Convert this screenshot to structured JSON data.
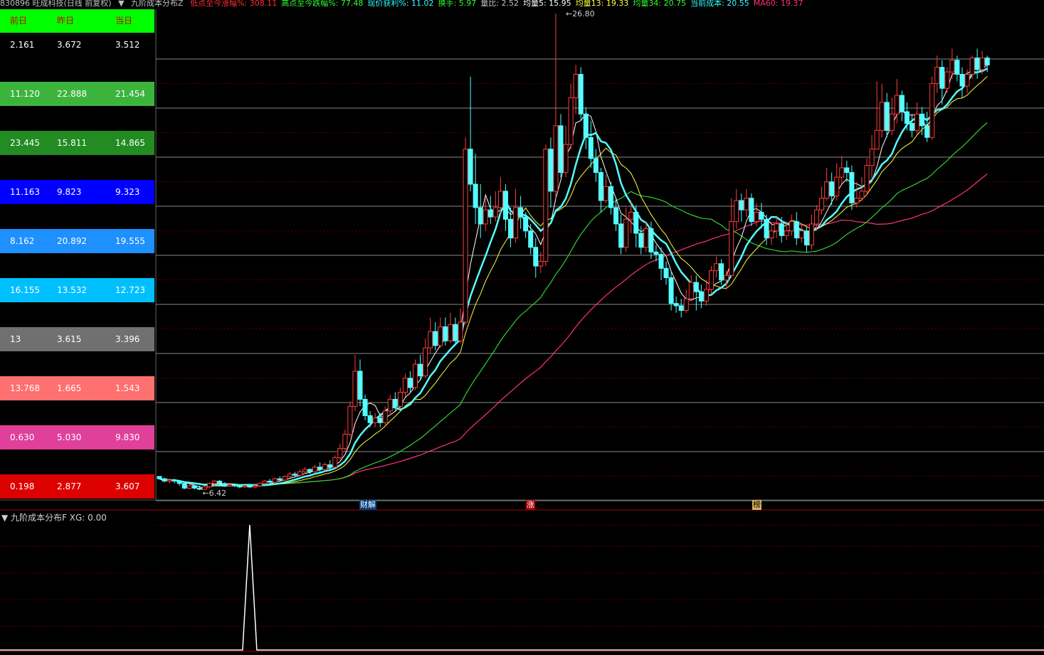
{
  "header": {
    "stock": "830896 旺成科技(日线 前复权)",
    "indicator": "九阶成本分布Z",
    "items": [
      {
        "label": "低点至今涨幅%: 308.11",
        "color": "#ff3030"
      },
      {
        "label": "高点至今跌幅%: 77.48",
        "color": "#30ff30"
      },
      {
        "label": "现价获利%: 11.02",
        "color": "#30ffff"
      },
      {
        "label": "换手: 5.97",
        "color": "#30ff30"
      },
      {
        "label": "量比: 2.52",
        "color": "#c0c0c0"
      },
      {
        "label": "均量5: 15.95",
        "color": "#ffffff"
      },
      {
        "label": "均量13: 19.33",
        "color": "#ffff40"
      },
      {
        "label": "均量34: 20.75",
        "color": "#30ff30"
      },
      {
        "label": "当前成本: 20.55",
        "color": "#30ffff"
      },
      {
        "label": "MA60: 19.37",
        "color": "#ff3080"
      }
    ]
  },
  "table": {
    "headers": [
      "前日",
      "昨日",
      "当日"
    ],
    "rows": [
      {
        "values": [
          "2.161",
          "3.672",
          "3.512"
        ],
        "bg": "#000000",
        "fg": "#ffffff"
      },
      {
        "values": [
          "11.120",
          "22.888",
          "21.454"
        ],
        "bg": "#3cb43c",
        "fg": "#ffffff"
      },
      {
        "values": [
          "23.445",
          "15.811",
          "14.865"
        ],
        "bg": "#228b22",
        "fg": "#ffffff"
      },
      {
        "values": [
          "11.163",
          "9.823",
          "9.323"
        ],
        "bg": "#0000ff",
        "fg": "#ffffff"
      },
      {
        "values": [
          "8.162",
          "20.892",
          "19.555"
        ],
        "bg": "#1e90ff",
        "fg": "#ffffff"
      },
      {
        "values": [
          "16.155",
          "13.532",
          "12.723"
        ],
        "bg": "#00bfff",
        "fg": "#ffffff"
      },
      {
        "values": [
          "13",
          "3.615",
          "3.396"
        ],
        "bg": "#707070",
        "fg": "#ffffff"
      },
      {
        "values": [
          "13.768",
          "1.665",
          "1.543"
        ],
        "bg": "#ff7070",
        "fg": "#ffffff"
      },
      {
        "values": [
          "0.630",
          "5.030",
          "9.830"
        ],
        "bg": "#e0409a",
        "fg": "#ffffff"
      },
      {
        "values": [
          "0.198",
          "2.877",
          "3.607"
        ],
        "bg": "#dd0000",
        "fg": "#ffffff"
      }
    ]
  },
  "annotations": {
    "high": "26.80",
    "low": "6.42"
  },
  "markers": [
    "财",
    "解",
    "涨",
    "榜"
  ],
  "lower": {
    "title": "九阶成本分布F  XG: 0.00"
  },
  "colors": {
    "up": "#ff3c3c",
    "down": "#54ffff",
    "ma5": "#ffffff",
    "ma13": "#ffff40",
    "ma34": "#30d030",
    "cost": "#54ffff",
    "ma60": "#ff3080"
  },
  "chart_data": {
    "type": "candlestick",
    "price_range": [
      6.42,
      26.8
    ],
    "candles": [
      [
        7.0,
        6.9,
        7.0,
        6.9
      ],
      [
        6.9,
        6.8,
        6.95,
        6.75
      ],
      [
        6.8,
        6.85,
        6.9,
        6.7
      ],
      [
        6.85,
        6.8,
        6.9,
        6.7
      ],
      [
        6.8,
        6.7,
        6.85,
        6.6
      ],
      [
        6.7,
        6.5,
        6.75,
        6.45
      ],
      [
        6.5,
        6.6,
        6.65,
        6.45
      ],
      [
        6.6,
        6.5,
        6.65,
        6.45
      ],
      [
        6.5,
        6.45,
        6.6,
        6.42
      ],
      [
        6.45,
        6.55,
        6.6,
        6.42
      ],
      [
        6.55,
        6.7,
        6.75,
        6.5
      ],
      [
        6.7,
        6.8,
        6.85,
        6.6
      ],
      [
        6.8,
        6.7,
        6.85,
        6.65
      ],
      [
        6.7,
        6.6,
        6.75,
        6.55
      ],
      [
        6.6,
        6.65,
        6.7,
        6.55
      ],
      [
        6.65,
        6.6,
        6.7,
        6.55
      ],
      [
        6.6,
        6.55,
        6.65,
        6.5
      ],
      [
        6.55,
        6.6,
        6.65,
        6.5
      ],
      [
        6.6,
        6.55,
        6.65,
        6.5
      ],
      [
        6.55,
        6.6,
        6.7,
        6.5
      ],
      [
        6.6,
        6.7,
        6.75,
        6.55
      ],
      [
        6.7,
        6.8,
        6.85,
        6.65
      ],
      [
        6.8,
        6.75,
        6.9,
        6.7
      ],
      [
        6.75,
        6.9,
        6.95,
        6.7
      ],
      [
        6.9,
        6.85,
        7.0,
        6.8
      ],
      [
        6.85,
        7.0,
        7.05,
        6.8
      ],
      [
        7.0,
        7.1,
        7.2,
        6.95
      ],
      [
        7.1,
        7.05,
        7.2,
        7.0
      ],
      [
        7.05,
        7.2,
        7.3,
        7.0
      ],
      [
        7.2,
        7.3,
        7.4,
        7.1
      ],
      [
        7.3,
        7.2,
        7.35,
        7.1
      ],
      [
        7.2,
        7.4,
        7.5,
        7.15
      ],
      [
        7.4,
        7.3,
        7.6,
        7.2
      ],
      [
        7.3,
        7.5,
        7.6,
        7.25
      ],
      [
        7.5,
        7.4,
        7.7,
        7.3
      ],
      [
        7.4,
        7.8,
        7.9,
        7.35
      ],
      [
        7.8,
        8.2,
        8.4,
        7.7
      ],
      [
        8.2,
        8.8,
        9.0,
        8.1
      ],
      [
        8.8,
        10.0,
        10.2,
        8.7
      ],
      [
        10.0,
        11.5,
        12.2,
        9.8
      ],
      [
        11.5,
        10.3,
        12.0,
        10.0
      ],
      [
        10.3,
        9.6,
        10.5,
        9.4
      ],
      [
        9.6,
        9.3,
        9.8,
        9.1
      ],
      [
        9.3,
        9.5,
        9.7,
        9.1
      ],
      [
        9.5,
        9.3,
        9.7,
        9.1
      ],
      [
        9.3,
        9.8,
        10.0,
        9.2
      ],
      [
        9.8,
        10.3,
        10.5,
        9.6
      ],
      [
        10.3,
        10.0,
        10.6,
        9.8
      ],
      [
        10.0,
        10.6,
        10.8,
        9.9
      ],
      [
        10.6,
        11.2,
        11.4,
        10.4
      ],
      [
        11.2,
        10.8,
        11.5,
        10.6
      ],
      [
        10.8,
        11.8,
        12.0,
        10.7
      ],
      [
        11.8,
        11.3,
        12.2,
        11.1
      ],
      [
        11.3,
        12.5,
        12.9,
        11.2
      ],
      [
        12.5,
        13.2,
        13.8,
        12.3
      ],
      [
        13.2,
        12.6,
        13.6,
        12.4
      ],
      [
        12.6,
        13.4,
        13.8,
        12.5
      ],
      [
        13.4,
        12.8,
        13.8,
        12.6
      ],
      [
        12.8,
        13.5,
        14.0,
        12.7
      ],
      [
        13.5,
        12.8,
        13.8,
        12.6
      ],
      [
        12.8,
        13.6,
        14.2,
        12.7
      ],
      [
        13.6,
        21.0,
        21.5,
        13.5
      ],
      [
        21.0,
        19.5,
        24.1,
        19.2
      ],
      [
        19.5,
        18.5,
        20.8,
        17.8
      ],
      [
        18.5,
        17.8,
        19.5,
        17.2
      ],
      [
        17.8,
        18.4,
        18.9,
        17.5
      ],
      [
        18.4,
        18.1,
        19.0,
        17.8
      ],
      [
        18.1,
        18.5,
        19.2,
        17.9
      ],
      [
        18.5,
        19.2,
        19.8,
        18.2
      ],
      [
        19.2,
        18.0,
        19.5,
        17.5
      ],
      [
        18.0,
        17.2,
        18.5,
        16.8
      ],
      [
        17.2,
        18.5,
        19.3,
        17.0
      ],
      [
        18.5,
        18.1,
        19.0,
        17.6
      ],
      [
        18.1,
        17.5,
        18.3,
        17.2
      ],
      [
        17.5,
        16.8,
        17.8,
        16.5
      ],
      [
        16.8,
        16.0,
        17.2,
        15.5
      ],
      [
        16.0,
        16.2,
        16.6,
        15.7
      ],
      [
        16.2,
        21.0,
        21.2,
        16.0
      ],
      [
        21.0,
        19.2,
        21.5,
        18.5
      ],
      [
        19.2,
        22.0,
        26.8,
        18.9
      ],
      [
        22.0,
        20.0,
        22.5,
        19.8
      ],
      [
        20.0,
        21.2,
        22.0,
        19.8
      ],
      [
        21.2,
        23.2,
        23.8,
        21.0
      ],
      [
        23.2,
        24.2,
        24.6,
        22.5
      ],
      [
        24.2,
        22.5,
        24.5,
        22.2
      ],
      [
        22.5,
        21.5,
        22.8,
        21.0
      ],
      [
        21.5,
        20.6,
        22.2,
        20.2
      ],
      [
        20.6,
        20.0,
        21.0,
        19.6
      ],
      [
        20.0,
        18.8,
        20.2,
        18.3
      ],
      [
        18.8,
        19.4,
        19.9,
        18.7
      ],
      [
        19.4,
        18.5,
        19.6,
        18.2
      ],
      [
        18.5,
        17.8,
        18.9,
        17.5
      ],
      [
        17.8,
        16.8,
        18.2,
        16.5
      ],
      [
        16.8,
        18.0,
        18.5,
        16.6
      ],
      [
        18.0,
        18.3,
        18.8,
        17.4
      ],
      [
        18.3,
        17.4,
        18.6,
        16.8
      ],
      [
        17.4,
        16.8,
        17.7,
        16.5
      ],
      [
        16.8,
        17.6,
        17.9,
        16.6
      ],
      [
        17.6,
        16.6,
        17.9,
        16.3
      ],
      [
        16.6,
        16.5,
        16.9,
        16.2
      ],
      [
        16.5,
        15.9,
        16.8,
        15.4
      ],
      [
        15.9,
        15.5,
        16.2,
        15.2
      ],
      [
        15.5,
        14.4,
        15.8,
        14.1
      ],
      [
        14.4,
        14.3,
        14.7,
        14.0
      ],
      [
        14.3,
        14.1,
        14.6,
        13.8
      ],
      [
        14.1,
        14.6,
        15.0,
        14.0
      ],
      [
        14.6,
        15.3,
        15.6,
        14.5
      ],
      [
        15.3,
        14.9,
        15.6,
        14.1
      ],
      [
        14.9,
        14.5,
        15.2,
        14.2
      ],
      [
        14.5,
        15.0,
        15.4,
        14.3
      ],
      [
        15.0,
        15.8,
        16.0,
        14.8
      ],
      [
        15.8,
        16.1,
        16.4,
        15.5
      ],
      [
        16.1,
        15.4,
        16.3,
        15.2
      ],
      [
        15.4,
        15.6,
        15.8,
        15.0
      ],
      [
        15.6,
        17.9,
        18.9,
        15.5
      ],
      [
        17.9,
        18.8,
        19.3,
        17.6
      ],
      [
        18.8,
        18.4,
        19.1,
        17.9
      ],
      [
        18.4,
        18.9,
        19.3,
        18.1
      ],
      [
        18.9,
        17.9,
        19.1,
        17.7
      ],
      [
        17.9,
        18.3,
        18.7,
        17.7
      ],
      [
        18.3,
        18.0,
        18.7,
        17.6
      ],
      [
        18.0,
        17.2,
        18.2,
        16.9
      ],
      [
        17.2,
        17.5,
        17.8,
        16.9
      ],
      [
        17.5,
        17.8,
        18.1,
        17.2
      ],
      [
        17.8,
        17.3,
        18.1,
        17.0
      ],
      [
        17.3,
        17.5,
        17.9,
        17.1
      ],
      [
        17.5,
        17.9,
        18.2,
        17.3
      ],
      [
        17.9,
        17.2,
        18.3,
        16.9
      ],
      [
        17.2,
        17.5,
        17.8,
        17.0
      ],
      [
        17.5,
        16.9,
        17.7,
        16.6
      ],
      [
        16.9,
        17.8,
        18.2,
        16.7
      ],
      [
        17.8,
        18.4,
        18.6,
        17.5
      ],
      [
        18.4,
        18.9,
        19.4,
        18.2
      ],
      [
        18.9,
        19.6,
        20.2,
        18.8
      ],
      [
        19.6,
        19.0,
        20.0,
        18.6
      ],
      [
        19.0,
        19.8,
        20.4,
        18.8
      ],
      [
        19.8,
        20.2,
        20.7,
        19.5
      ],
      [
        20.2,
        20.0,
        20.5,
        19.6
      ],
      [
        20.0,
        18.7,
        20.3,
        18.4
      ],
      [
        18.7,
        18.9,
        19.6,
        18.5
      ],
      [
        18.9,
        19.2,
        19.8,
        18.8
      ],
      [
        19.2,
        20.3,
        20.6,
        19.0
      ],
      [
        20.3,
        21.0,
        21.6,
        19.7
      ],
      [
        21.0,
        21.8,
        23.9,
        21.2
      ],
      [
        21.8,
        23.0,
        23.8,
        21.5
      ],
      [
        23.0,
        21.8,
        23.4,
        21.5
      ],
      [
        21.8,
        22.5,
        23.2,
        21.6
      ],
      [
        22.5,
        23.3,
        24.0,
        22.1
      ],
      [
        23.3,
        22.6,
        23.5,
        22.2
      ],
      [
        22.6,
        22.1,
        23.0,
        21.8
      ],
      [
        22.1,
        21.8,
        22.5,
        21.5
      ],
      [
        21.8,
        22.5,
        23.0,
        21.6
      ],
      [
        22.5,
        22.0,
        22.8,
        21.6
      ],
      [
        22.0,
        21.5,
        22.6,
        21.3
      ],
      [
        21.5,
        23.8,
        24.1,
        21.4
      ],
      [
        23.8,
        24.5,
        25.0,
        23.4
      ],
      [
        24.5,
        23.6,
        24.8,
        22.9
      ],
      [
        23.6,
        24.3,
        24.5,
        23.4
      ],
      [
        24.3,
        24.8,
        25.3,
        24.0
      ],
      [
        24.8,
        24.2,
        25.0,
        23.9
      ],
      [
        24.2,
        23.7,
        24.5,
        23.2
      ],
      [
        23.7,
        24.2,
        24.4,
        23.4
      ],
      [
        24.2,
        24.9,
        25.0,
        24.0
      ],
      [
        24.9,
        24.4,
        25.3,
        24.0
      ],
      [
        24.4,
        24.9,
        25.2,
        24.2
      ],
      [
        24.9,
        24.6,
        25.0,
        24.3
      ]
    ],
    "lower_signal": {
      "peak_index": 18,
      "peak_value": 1,
      "y_range": [
        0,
        1
      ]
    }
  }
}
